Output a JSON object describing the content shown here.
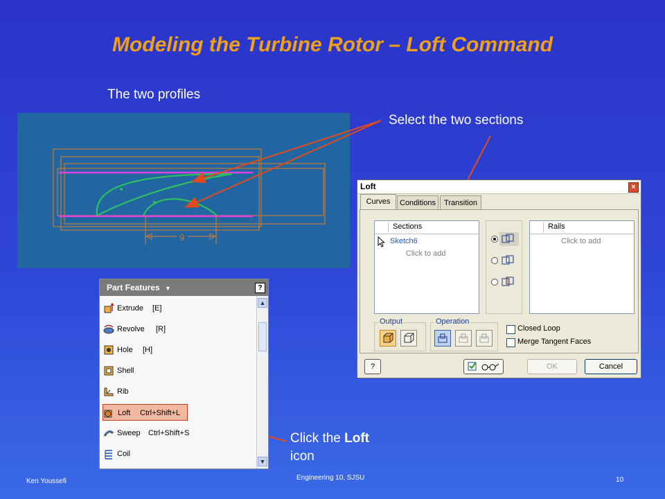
{
  "slide": {
    "title": "Modeling the Turbine Rotor – Loft Command",
    "caption_profiles": "The two profiles",
    "caption_select": "Select the two sections",
    "caption_click_prefix": "Click the ",
    "caption_click_bold": "Loft",
    "caption_click_suffix": "icon",
    "footer_left": "Ken Youssefi",
    "footer_center": "Engineering 10, SJSU",
    "page_number": "10",
    "colors": {
      "title": "#f0a018",
      "arrow": "#e24a1c",
      "background": "#2e47d8"
    }
  },
  "sketch": {
    "dimension_value": "9",
    "colors": {
      "background": "#2166a0",
      "frames": "#c47a36",
      "profile": "#2ec060",
      "axis": "#e040e0"
    }
  },
  "part_features": {
    "header": "Part Features",
    "header_icon": "dropdown-arrow-icon",
    "help": "?",
    "items": [
      {
        "label": "Extrude",
        "shortcut": "[E]",
        "icon": "extrude-icon"
      },
      {
        "label": "Revolve",
        "shortcut": "[R]",
        "icon": "revolve-icon"
      },
      {
        "label": "Hole",
        "shortcut": "[H]",
        "icon": "hole-icon"
      },
      {
        "label": "Shell",
        "shortcut": "",
        "icon": "shell-icon"
      },
      {
        "label": "Rib",
        "shortcut": "",
        "icon": "rib-icon"
      },
      {
        "label": "Loft",
        "shortcut": "Ctrl+Shift+L",
        "icon": "loft-icon",
        "highlighted": true
      },
      {
        "label": "Sweep",
        "shortcut": "Ctrl+Shift+S",
        "icon": "sweep-icon"
      },
      {
        "label": "Coil",
        "shortcut": "",
        "icon": "coil-icon"
      }
    ]
  },
  "loft_dialog": {
    "title": "Loft",
    "close": "×",
    "tabs": [
      "Curves",
      "Conditions",
      "Transition"
    ],
    "active_tab": "Curves",
    "sections": {
      "header": "Sections",
      "items": [
        "Sketch6"
      ],
      "placeholder": "Click to add"
    },
    "rails": {
      "header": "Rails",
      "placeholder": "Click to add"
    },
    "output_label": "Output",
    "operation_label": "Operation",
    "closed_loop": "Closed Loop",
    "merge_tangent": "Merge Tangent Faces",
    "closed_loop_checked": false,
    "merge_tangent_checked": false,
    "ok": "OK",
    "cancel": "Cancel",
    "help": "?"
  }
}
